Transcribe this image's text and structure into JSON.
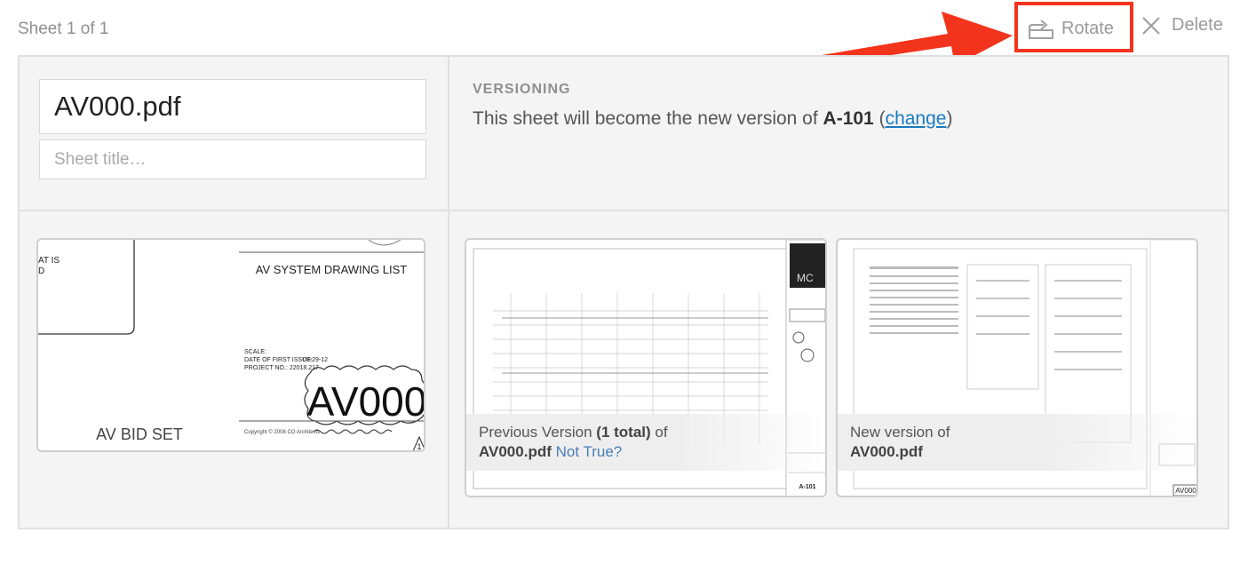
{
  "header": {
    "sheet_count": "Sheet 1 of 1",
    "rotate_label": "Rotate",
    "delete_label": "Delete"
  },
  "form": {
    "filename_value": "AV000.pdf",
    "title_placeholder": "Sheet title…"
  },
  "versioning": {
    "label": "VERSIONING",
    "text_before": "This sheet will become the new version of ",
    "sheet_code": "A-101",
    "paren_open": " (",
    "change_label": "change",
    "paren_close": ")"
  },
  "current_sheet": {
    "text_at": "AT  IS",
    "text_d": "D",
    "drawing_list_title": "AV SYSTEM DRAWING LIST",
    "scale": "SCALE:",
    "date_label": "DATE OF FIRST ISSUE:",
    "date_value": "08-29-12",
    "project_no": "PROJECT NO.: 22018.217",
    "sheet_number": "AV000",
    "set_name": "AV  BID  SET",
    "copyright": "Copyright © 2008  CO Architects",
    "revision": "1"
  },
  "previous_version": {
    "caption_prefix": "Previous Version ",
    "total": "(1 total)",
    "caption_of": " of",
    "filename": "AV000.pdf",
    "not_true_label": "Not True?",
    "stamp_top": "MC",
    "sheet_code": "A-101"
  },
  "new_version": {
    "caption": "New version of",
    "filename": "AV000.pdf",
    "corner_label": "AV000"
  },
  "colors": {
    "annotation_red": "#f2341c",
    "link_blue": "#1a7bbf"
  }
}
